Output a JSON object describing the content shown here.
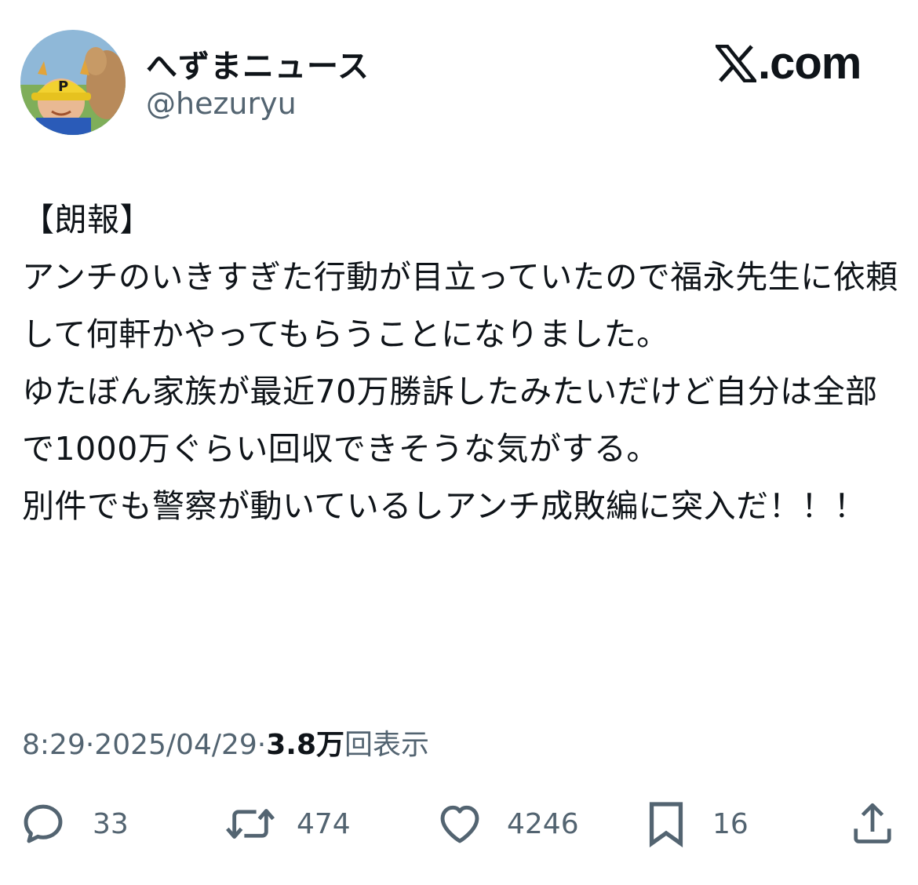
{
  "author": {
    "display_name": "へずまニュース",
    "handle": "@hezuryu",
    "avatar_icon": "avatar-photo-icon"
  },
  "brand": {
    "domain_suffix": ".com",
    "logo_icon": "x-logo-icon"
  },
  "post": {
    "text": "【朗報】\nアンチのいきすぎた行動が目立っていたので福永先生に依頼して何軒かやってもらうことになりました。\nゆたぼん家族が最近70万勝訴したみたいだけど自分は全部で1000万ぐらい回収できそうな気がする。\n別件でも警察が動いているしアンチ成敗編に突入だ！！！"
  },
  "meta": {
    "time": "8:29",
    "separator": " · ",
    "date": "2025/04/29",
    "views_count": "3.8万",
    "views_label": "回表示"
  },
  "actions": {
    "reply": {
      "icon": "reply-icon",
      "count": "33"
    },
    "repost": {
      "icon": "repost-icon",
      "count": "474"
    },
    "like": {
      "icon": "heart-icon",
      "count": "4246"
    },
    "bookmark": {
      "icon": "bookmark-icon",
      "count": "16"
    },
    "share": {
      "icon": "share-icon"
    }
  },
  "colors": {
    "text": "#0f1419",
    "secondary": "#536471",
    "background": "#ffffff"
  }
}
